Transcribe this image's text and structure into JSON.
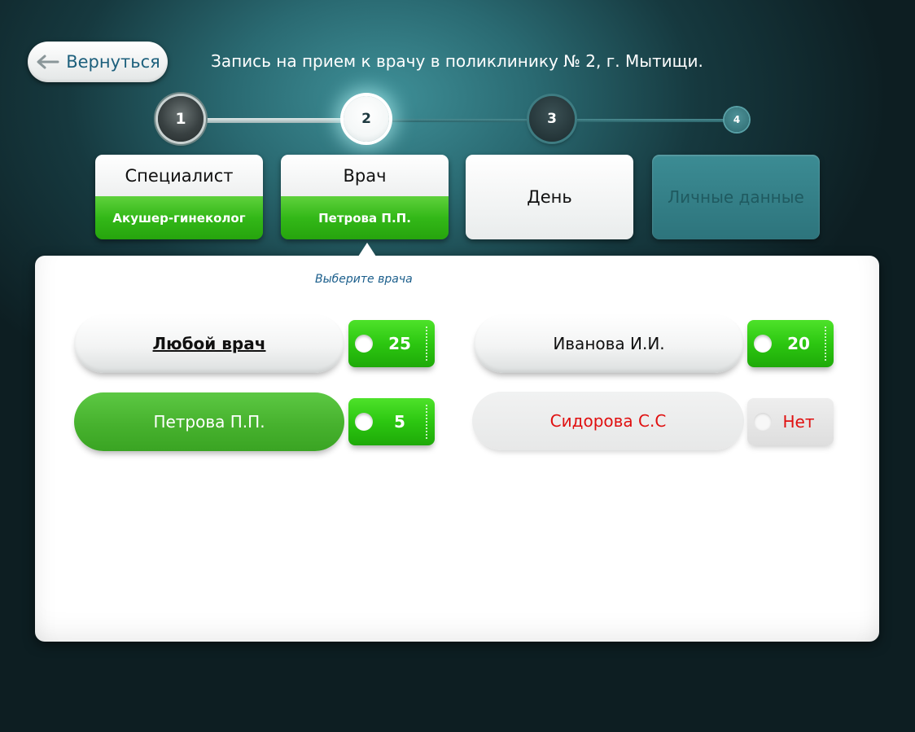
{
  "header": {
    "back_label": "Вернуться",
    "title": "Запись на прием к врачу в поликлинику № 2, г. Мытищи."
  },
  "steps": [
    {
      "number": "1",
      "state": "completed"
    },
    {
      "number": "2",
      "state": "current"
    },
    {
      "number": "3",
      "state": "upcoming"
    },
    {
      "number": "4",
      "state": "upcoming"
    }
  ],
  "tabs": {
    "specialist": {
      "label": "Специалист",
      "value": "Акушер-гинеколог"
    },
    "doctor": {
      "label": "Врач",
      "value": "Петрова П.П."
    },
    "day": {
      "label": "День"
    },
    "personal": {
      "label": "Личные данные"
    }
  },
  "panel": {
    "hint": "Выберите врача",
    "doctors": [
      {
        "name": "Любой врач",
        "slots": "25",
        "state": "default"
      },
      {
        "name": "Иванова И.И.",
        "slots": "20",
        "state": "default"
      },
      {
        "name": "Петрова П.П.",
        "slots": "5",
        "state": "selected"
      },
      {
        "name": "Сидорова С.С",
        "slots": "Нет",
        "state": "unavailable"
      }
    ]
  },
  "colors": {
    "accent_green": "#33b818",
    "unavailable_red": "#e01010",
    "link_blue": "#1c5f7c"
  }
}
